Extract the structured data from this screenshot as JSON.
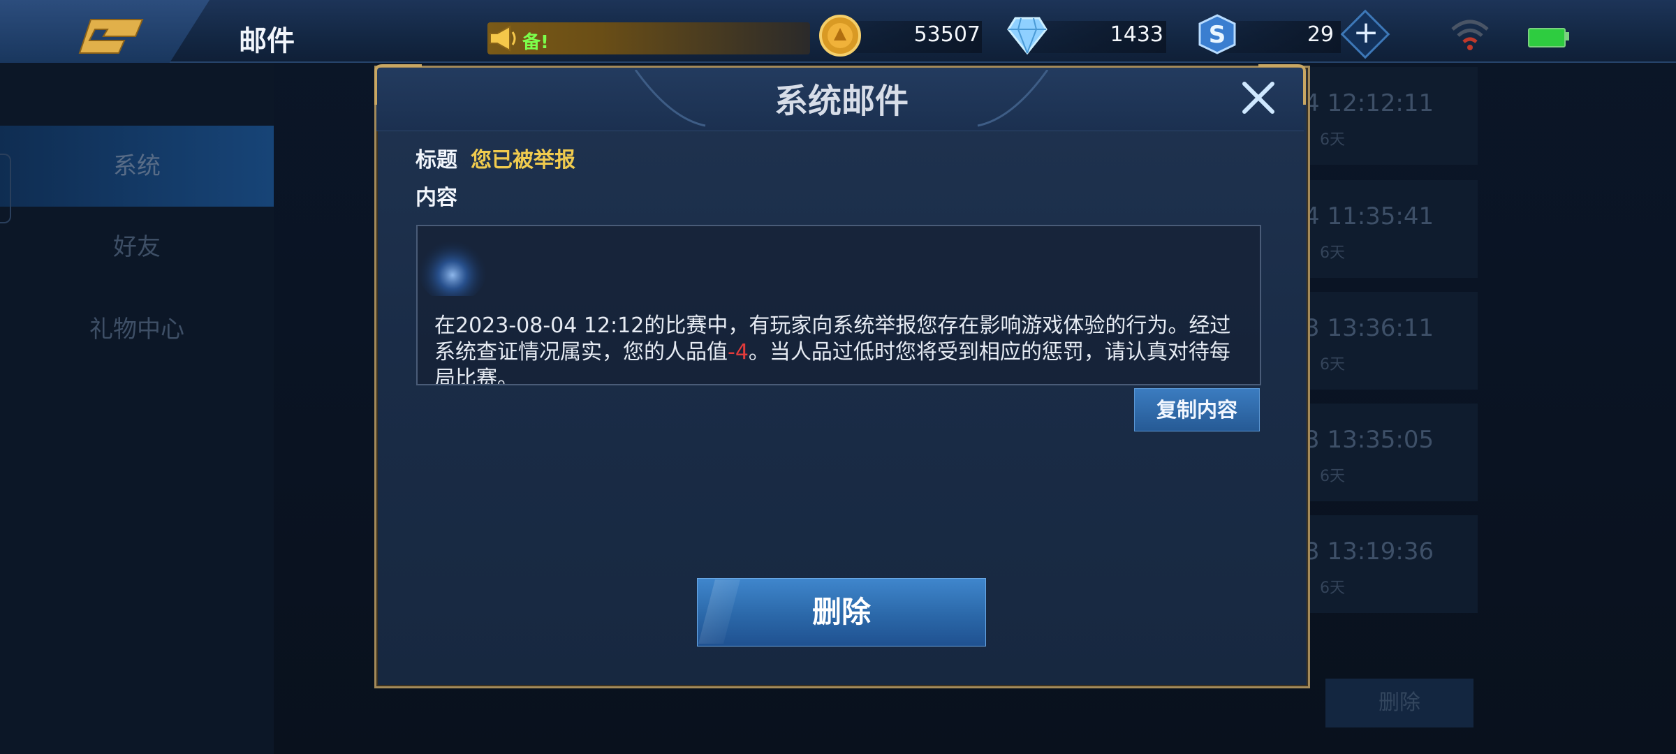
{
  "header": {
    "title": "邮件",
    "broadcast_text": "备!",
    "currencies": [
      {
        "name": "gold-coin",
        "value": "53507"
      },
      {
        "name": "diamond",
        "value": "1433"
      },
      {
        "name": "voucher",
        "value": "29"
      }
    ]
  },
  "sidebar": {
    "items": [
      {
        "label": "系统"
      },
      {
        "label": "好友"
      },
      {
        "label": "礼物中心"
      }
    ]
  },
  "mail_list": {
    "rows": [
      {
        "time": "4 12:12:11",
        "age": "6天"
      },
      {
        "time": "4 11:35:41",
        "age": "6天"
      },
      {
        "time": "3 13:36:11",
        "age": "6天"
      },
      {
        "time": "3 13:35:05",
        "age": "6天"
      },
      {
        "time": "3 13:19:36",
        "age": "6天"
      }
    ],
    "delete_label": "删除"
  },
  "dialog": {
    "title": "系统邮件",
    "subject_label": "标题",
    "subject_value": "您已被举报",
    "content_label": "内容",
    "content_part1": "在2023-08-04 12:12的比赛中，有玩家向系统举报您存在影响游戏体验的行为。经过系统查证情况属实，您的人品值",
    "content_penalty": "-4",
    "content_part2": "。当人品过低时您将受到相应的惩罚，请认真对待每局比赛。",
    "copy_label": "复制内容",
    "delete_label": "删除"
  },
  "colors": {
    "accent_gold": "#f0cb4e",
    "penalty_red": "#e23b3b",
    "button_blue": "#2b68a9"
  }
}
